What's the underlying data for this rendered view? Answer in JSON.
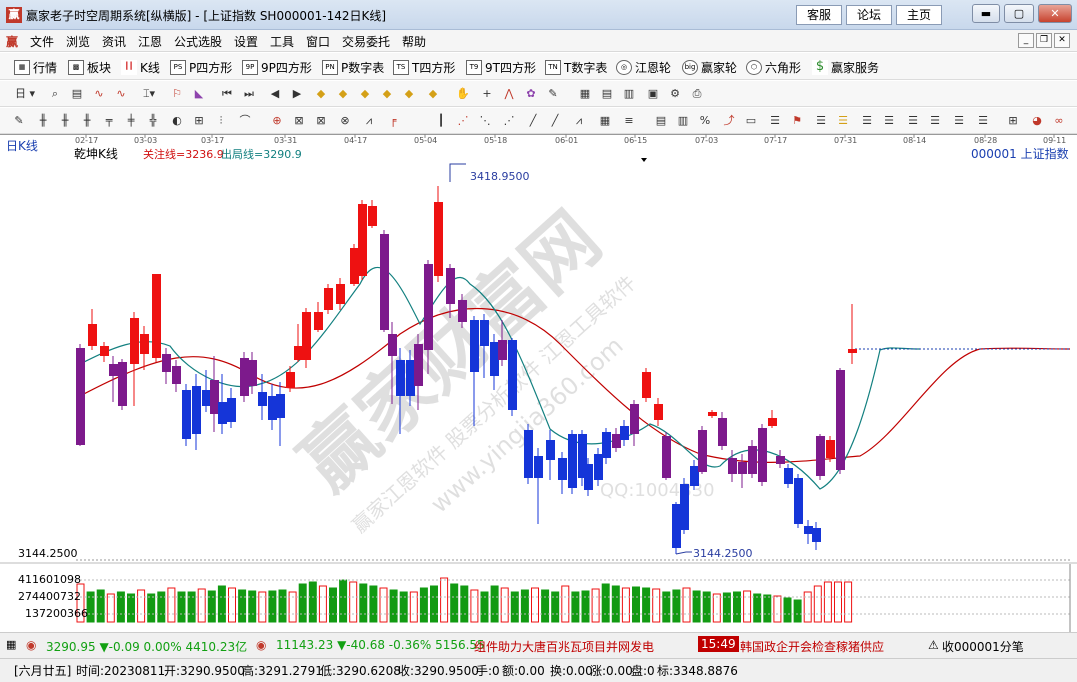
{
  "window": {
    "title": "赢家老子时空周期系统[纵横版] - [上证指数  SH000001-142日K线]",
    "links": [
      "客服",
      "论坛",
      "主页"
    ],
    "icon_label": "赢"
  },
  "menu": {
    "logo": "赢",
    "items": [
      "文件",
      "浏览",
      "资讯",
      "江恩",
      "公式选股",
      "设置",
      "工具",
      "窗口",
      "交易委托",
      "帮助"
    ]
  },
  "toolbar1": {
    "items": [
      {
        "icon": "grid-icon",
        "label": "行情"
      },
      {
        "icon": "blocks-icon",
        "label": "板块"
      },
      {
        "icon": "candle-icon",
        "label": "K线"
      },
      {
        "icon": "PS",
        "label": "P四方形"
      },
      {
        "icon": "9P",
        "label": "9P四方形"
      },
      {
        "icon": "PN",
        "label": "P数字表"
      },
      {
        "icon": "TS",
        "label": "T四方形"
      },
      {
        "icon": "T9",
        "label": "9T四方形"
      },
      {
        "icon": "TN",
        "label": "T数字表"
      },
      {
        "icon": "wheel-icon",
        "label": "江恩轮"
      },
      {
        "icon": "big",
        "label": "赢家轮"
      },
      {
        "icon": "hex-icon",
        "label": "六角形"
      },
      {
        "icon": "dollar-icon",
        "label": "赢家服务"
      }
    ]
  },
  "toolbar2": {
    "period": "日"
  },
  "chart": {
    "period_label": "日K线",
    "indicator_name": "乾坤K线",
    "watch_line": "关注线=3236.9",
    "exit_line": "出局线=3290.9",
    "symbol": "000001 上证指数",
    "high_label": "3418.9500",
    "low_label": "3144.2500",
    "min_price_label": "3144.2500",
    "dates": [
      "02-17",
      "03-03",
      "03-17",
      "03-31",
      "04-17",
      "05-04",
      "05-18",
      "06-01",
      "06-15",
      "07-03",
      "07-17",
      "07-31",
      "08-14",
      "08-28",
      "09-11"
    ],
    "volume_ticks": [
      "411601098",
      "274400732",
      "137200366"
    ],
    "watermark": "赢家财富网",
    "watermark2": "赢家江恩软件 股票分析软件 江恩工具软件",
    "watermark3": "www.yingjia360.com",
    "watermark4": "QQ:1004830"
  },
  "chart_data": {
    "type": "candlestick",
    "title": "上证指数 日K线",
    "y_high": 3418.95,
    "y_low": 3144.25,
    "last_close": 3290.95,
    "watch_line": 3236.9,
    "exit_line": 3290.9
  },
  "status1": {
    "index1": "3290.95 ▼-0.09 0.00% 4410.23亿",
    "index2": "11143.23 ▼-40.68 -0.36% 5156.55",
    "news1": "组件助力大唐百兆瓦项目并网发电",
    "news_time": "15:49",
    "news2": "韩国政企开会检查稼猪供应",
    "right": "收000001分笔"
  },
  "status2": {
    "date": "[六月廿五]",
    "time": "时间:20230811",
    "open": "开:3290.9500",
    "high": "高:3291.2791",
    "low": "低:3290.6208",
    "close": "收:3290.9500",
    "hand": "手:0",
    "amount": "额:0.00",
    "turnover": "换:0.00",
    "change": "涨:0.00",
    "pan": "盘:0",
    "mark": "标:3348.8876"
  }
}
